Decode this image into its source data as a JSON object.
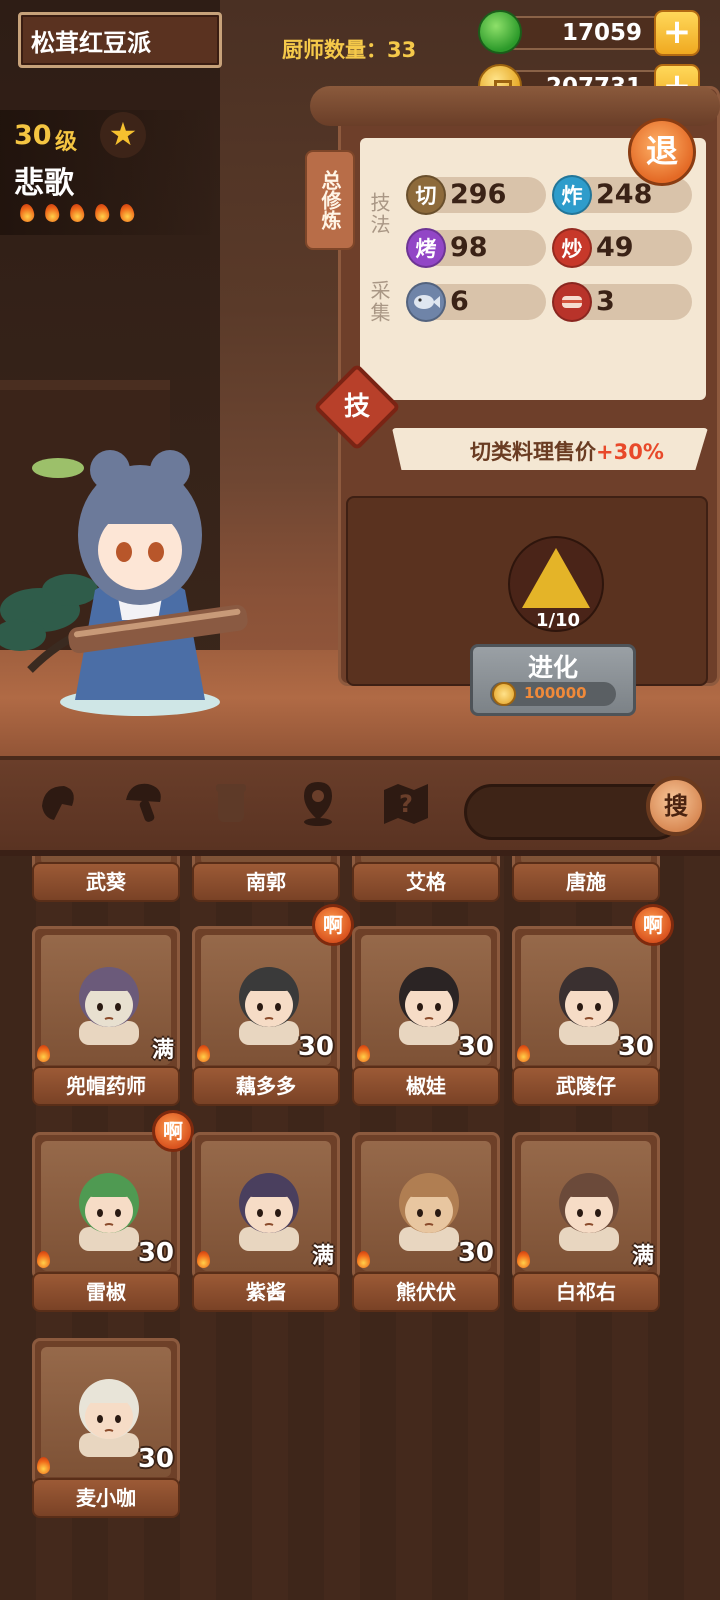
{
  "header": {
    "school_name": "松茸红豆派",
    "chef_count": "厨师数量：33"
  },
  "currencies": {
    "jade": "17059",
    "gold": "207731"
  },
  "chef": {
    "level": "30",
    "level_unit": "级",
    "name": "悲歌",
    "flame_count": 5
  },
  "panel": {
    "tab_label": "总修炼",
    "retreat_label": "退",
    "section_technique": "技法",
    "section_gather": "采集",
    "stats": [
      {
        "icon": "切",
        "value": "296",
        "color": "#8d6a3b"
      },
      {
        "icon": "炸",
        "value": "248",
        "color": "#2e9ccb"
      },
      {
        "icon": "烤",
        "value": "98",
        "color": "#9246c6"
      },
      {
        "icon": "炒",
        "value": "49",
        "color": "#c7382a"
      },
      {
        "icon": "fish-icon",
        "value": "6",
        "color": "#6f84a8"
      },
      {
        "icon": "meat-icon",
        "value": "3",
        "color": "#b8332a"
      }
    ],
    "skill_badge": "技",
    "bonus_text": "切类料理售价",
    "bonus_value": "+30%",
    "evolution_progress": "1/10",
    "evolve_label": "进化",
    "evolve_cost": "100000"
  },
  "toolbar": {
    "search_label": "搜"
  },
  "chefs_row_partial": [
    "武葵",
    "南郭",
    "艾格",
    "唐施"
  ],
  "chefs": [
    {
      "name": "兜帽药师",
      "level": "满",
      "shout": false
    },
    {
      "name": "藕多多",
      "level": "30",
      "shout": true
    },
    {
      "name": "椒娃",
      "level": "30",
      "shout": false
    },
    {
      "name": "武陵仔",
      "level": "30",
      "shout": true
    },
    {
      "name": "雷椒",
      "level": "30",
      "shout": true
    },
    {
      "name": "紫酱",
      "level": "满",
      "shout": false
    },
    {
      "name": "熊伏伏",
      "level": "30",
      "shout": false
    },
    {
      "name": "白祁右",
      "level": "满",
      "shout": false
    },
    {
      "name": "麦小咖",
      "level": "30",
      "shout": false
    }
  ],
  "shout_label": "啊",
  "colors": {
    "accent_gold": "#f4c542",
    "bonus_highlight": "#e8492a"
  }
}
